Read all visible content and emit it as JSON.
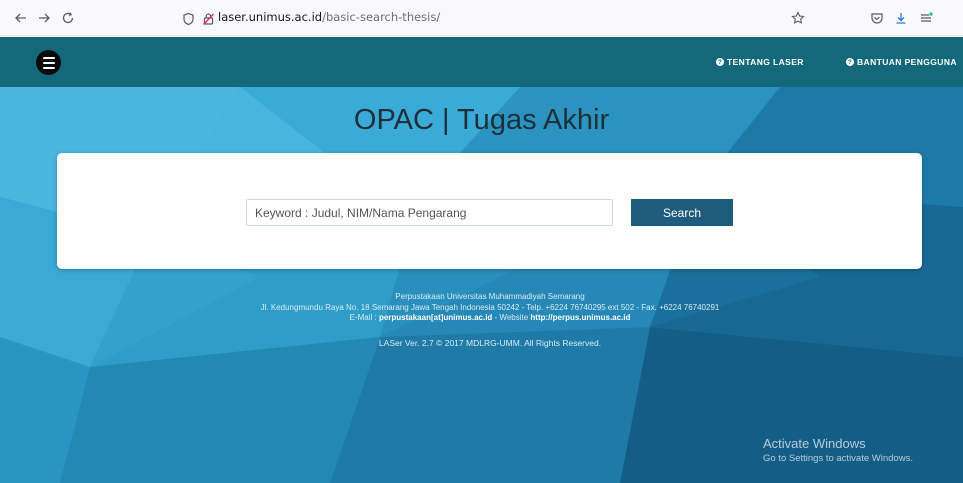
{
  "browser": {
    "url_host": "laser.unimus.ac.id",
    "url_path": "/basic-search-thesis/"
  },
  "nav": {
    "links": [
      "TENTANG LASER",
      "BANTUAN PENGGUNA"
    ]
  },
  "page": {
    "title": "OPAC | Tugas Akhir"
  },
  "search": {
    "placeholder": "Keyword : Judul, NIM/Nama Pengarang",
    "button_label": "Search"
  },
  "footer": {
    "line1": "Perpustakaan Universitas Muhammadiyah Semarang",
    "line2": "Jl. Kedungmundu Raya No. 18 Semarang Jawa Tengah Indonesia 50242 - Telp. +6224 76740295 ext 502 - Fax. +6224 76740291",
    "email_label": "E-Mail :",
    "email": "perpustakaan[at]unimus.ac.id",
    "website_label": "- Website",
    "website": "http://perpus.unimus.ac.id",
    "copyright": "LASer Ver. 2.7 © 2017 MDLRG-UMM. All Rights Reserved."
  },
  "watermark": {
    "title": "Activate Windows",
    "subtitle": "Go to Settings to activate Windows."
  },
  "colors": {
    "navbar": "#136979",
    "button": "#1e5b7d",
    "background": "#2e9ec9"
  }
}
